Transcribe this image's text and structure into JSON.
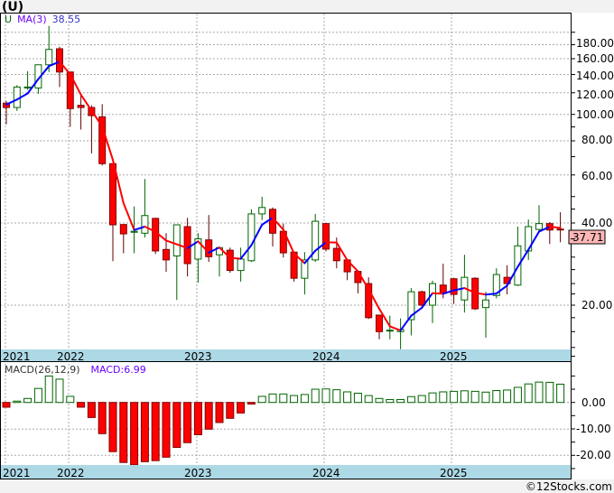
{
  "header": {
    "title": "(U)"
  },
  "footer": {
    "copyright": "©12Stocks.com"
  },
  "colors": {
    "up": "#006400",
    "down": "#ff0000",
    "down_edge": "#800000",
    "ma_up": "#0000ff",
    "ma_down": "#ff0000",
    "band": "#add8e6",
    "last_price_bg": "#ffb6b6"
  },
  "chart_data": [
    {
      "type": "candlestick",
      "title": "(U)",
      "legend": {
        "symbol": "U",
        "indicator": "MA(3)",
        "value": "38.55"
      },
      "scale": "log",
      "yticks": [
        "180.00",
        "160.00",
        "140.00",
        "120.00",
        "100.00",
        "80.00",
        "60.00",
        "40.00",
        "20.00"
      ],
      "ytick_values": [
        180,
        160,
        140,
        120,
        100,
        80,
        60,
        40,
        20
      ],
      "gridlines": [
        200,
        180,
        160,
        140,
        120,
        100,
        80,
        60,
        40,
        20
      ],
      "last_price": "37.71",
      "years": [
        "2021",
        "2022",
        "2023",
        "2024",
        "2025"
      ],
      "interval": "monthly",
      "ohlc": [
        [
          110,
          112,
          92,
          106
        ],
        [
          106,
          128,
          103,
          126
        ],
        [
          125,
          144,
          123,
          126
        ],
        [
          125,
          152,
          119,
          152
        ],
        [
          152,
          211,
          143,
          173
        ],
        [
          174,
          177,
          126,
          143
        ],
        [
          143,
          143,
          90,
          105
        ],
        [
          108,
          118,
          88,
          106
        ],
        [
          106,
          108,
          72,
          99
        ],
        [
          98,
          109,
          65,
          66
        ],
        [
          66,
          66,
          29,
          39.4
        ],
        [
          39.5,
          39.5,
          31,
          36.5
        ],
        [
          37,
          46,
          31,
          37.3
        ],
        [
          36.7,
          58,
          35.4,
          42.6
        ],
        [
          41.6,
          41.8,
          30.8,
          31.6
        ],
        [
          32,
          36.7,
          26.5,
          29.3
        ],
        [
          30.3,
          39.4,
          20.9,
          39.4
        ],
        [
          38.8,
          41.8,
          25.5,
          28.4
        ],
        [
          29.5,
          36.7,
          24.2,
          35
        ],
        [
          34.7,
          42.8,
          28.8,
          30.1
        ],
        [
          30.6,
          32.5,
          25.5,
          32.5
        ],
        [
          31.8,
          32.5,
          26.3,
          26.8
        ],
        [
          26.8,
          32.5,
          24.4,
          29.5
        ],
        [
          29.1,
          44.9,
          28.8,
          43.2
        ],
        [
          43.2,
          49.9,
          41,
          45.6
        ],
        [
          44.9,
          45.6,
          32.8,
          36.7
        ],
        [
          37.3,
          39.8,
          29.9,
          31.1
        ],
        [
          31.3,
          31.3,
          24.4,
          25.1
        ],
        [
          25.1,
          31.3,
          21.9,
          29.3
        ],
        [
          29.3,
          43.2,
          28.8,
          40.6
        ],
        [
          39.8,
          40,
          31.5,
          32.1
        ],
        [
          32.3,
          35.4,
          27.3,
          29.1
        ],
        [
          29.3,
          29.3,
          24.7,
          26.5
        ],
        [
          26.6,
          26.6,
          22.1,
          24.2
        ],
        [
          24,
          25.3,
          17.8,
          18
        ],
        [
          18.4,
          18.4,
          15,
          16
        ],
        [
          16.1,
          18.3,
          15,
          16.2
        ],
        [
          16,
          17.9,
          13.8,
          16.3
        ],
        [
          17.7,
          23.1,
          15.5,
          22.4
        ],
        [
          22.4,
          22.6,
          19.8,
          20
        ],
        [
          20,
          24.6,
          17.2,
          24
        ],
        [
          23.7,
          28.4,
          21.2,
          22.1
        ],
        [
          25,
          25.2,
          20.2,
          21.9
        ],
        [
          20.9,
          30.6,
          18.8,
          25.3
        ],
        [
          25.1,
          25.3,
          19.2,
          19.4
        ],
        [
          19.6,
          22.4,
          15.2,
          20.9
        ],
        [
          21.7,
          27.3,
          21.2,
          25.9
        ],
        [
          25.3,
          28,
          21.9,
          24
        ],
        [
          23.7,
          38.8,
          23.5,
          33
        ],
        [
          31.6,
          41.2,
          29.3,
          38.8
        ],
        [
          37.9,
          46.5,
          37.5,
          39.8
        ],
        [
          39.8,
          40.3,
          33.5,
          37.7
        ],
        [
          38,
          43.8,
          34,
          37.71
        ]
      ],
      "ma_prior_closes": [
        112,
        108
      ]
    },
    {
      "type": "bar",
      "title": "MACD(26,12,9)",
      "legend": {
        "label": "MACD(26,12,9)",
        "value": "MACD:6.99"
      },
      "yticks": [
        "0.00",
        "-10.00",
        "-20.00"
      ],
      "ytick_values": [
        0,
        -10,
        -20
      ],
      "years": [
        "2021",
        "2022",
        "2023",
        "2024",
        "2025"
      ],
      "values": [
        -1.8,
        0.5,
        1.5,
        5.3,
        10,
        8.8,
        2.3,
        -1.8,
        -5.7,
        -11.8,
        -18.6,
        -22.7,
        -23.6,
        -22.4,
        -22,
        -20.7,
        -17,
        -15.2,
        -12.2,
        -10.1,
        -7.6,
        -6,
        -4,
        -0.6,
        2.3,
        3.2,
        3.2,
        2.6,
        3,
        5,
        5.1,
        4.8,
        4,
        3.5,
        2.6,
        1.5,
        1.1,
        1.1,
        2.2,
        2.6,
        3.6,
        4,
        4.2,
        4.4,
        4.2,
        3.9,
        4.5,
        4.7,
        5.7,
        7,
        7.7,
        7.6,
        6.9
      ]
    }
  ]
}
